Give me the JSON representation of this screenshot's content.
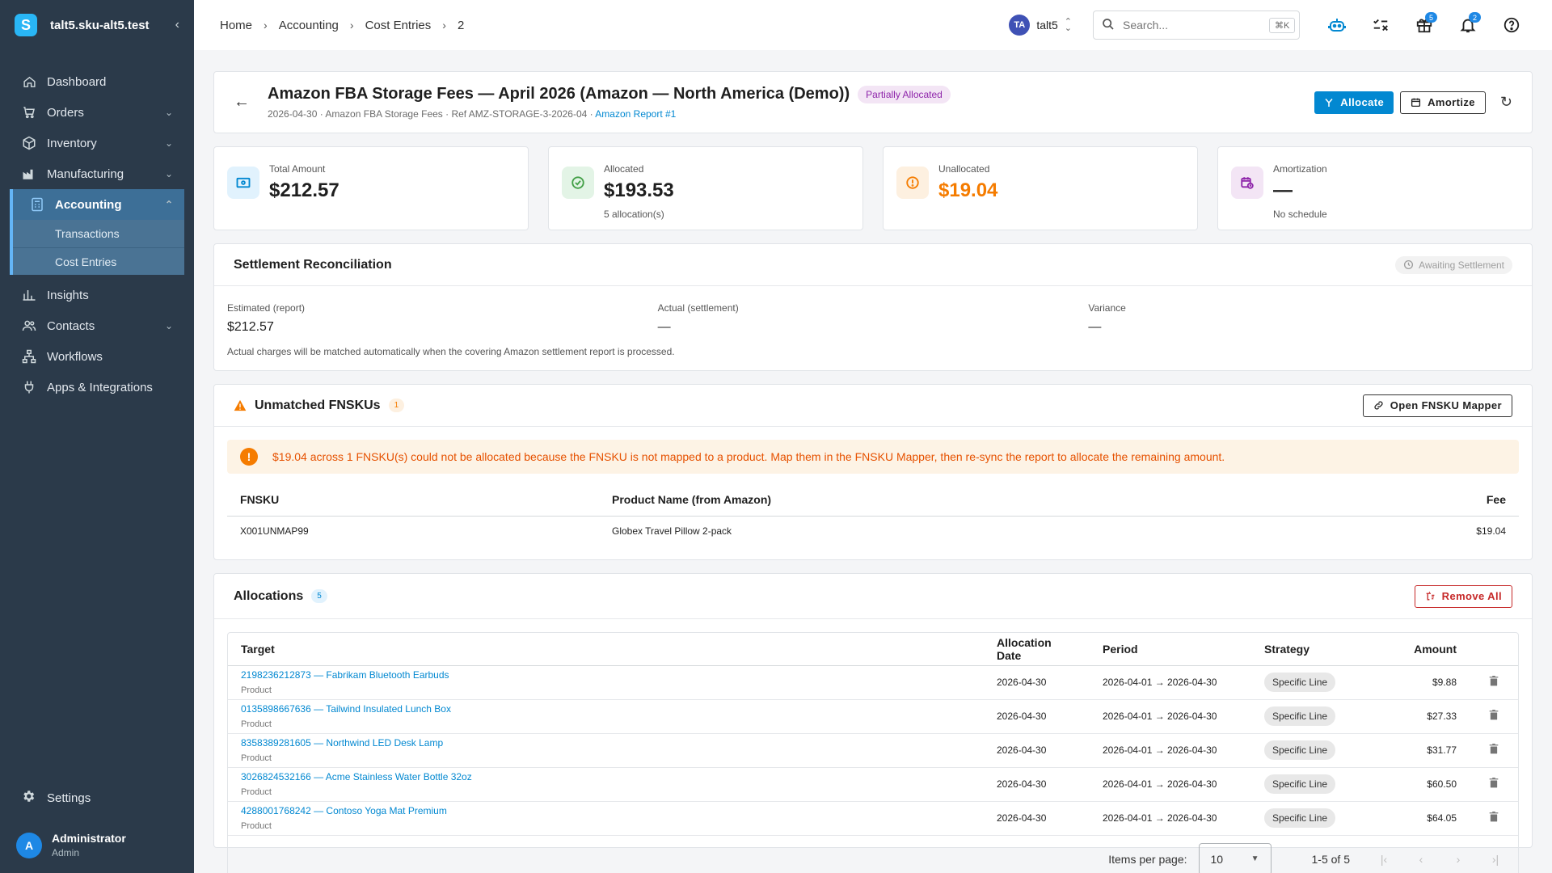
{
  "sidebar": {
    "tenant": "talt5.sku-alt5.test",
    "logo_letter": "S",
    "items": [
      {
        "label": "Dashboard",
        "icon": "home-icon"
      },
      {
        "label": "Orders",
        "icon": "cart-icon"
      },
      {
        "label": "Inventory",
        "icon": "box-icon"
      },
      {
        "label": "Manufacturing",
        "icon": "factory-icon"
      },
      {
        "label": "Accounting",
        "icon": "calculator-icon"
      },
      {
        "label": "Insights",
        "icon": "bar-chart-icon"
      },
      {
        "label": "Contacts",
        "icon": "people-icon"
      },
      {
        "label": "Workflows",
        "icon": "workflow-icon"
      },
      {
        "label": "Apps & Integrations",
        "icon": "plug-icon"
      }
    ],
    "accounting_sub": [
      "Transactions",
      "Cost Entries"
    ],
    "settings": "Settings",
    "user": {
      "initial": "A",
      "name": "Administrator",
      "role": "Admin"
    }
  },
  "topbar": {
    "breadcrumbs": [
      "Home",
      "Accounting",
      "Cost Entries",
      "2"
    ],
    "tenant_initials": "TA",
    "tenant_name": "talt5",
    "search_placeholder": "Search...",
    "search_shortcut": "⌘K",
    "gift_badge": "5",
    "bell_badge": "2"
  },
  "header": {
    "title": "Amazon FBA Storage Fees — April 2026 (Amazon — North America (Demo))",
    "status": "Partially Allocated",
    "sub_text": "2026-04-30 · Amazon FBA Storage Fees · Ref AMZ-STORAGE-3-2026-04 · ",
    "sub_link": "Amazon Report #1",
    "allocate": "Allocate",
    "amortize": "Amortize"
  },
  "stats": [
    {
      "label": "Total Amount",
      "value": "$212.57",
      "sub": "",
      "color": "#1f1f1f",
      "icon": "cash-icon"
    },
    {
      "label": "Allocated",
      "value": "$193.53",
      "sub": "5 allocation(s)",
      "color": "#1f1f1f",
      "icon": "check-circle-icon"
    },
    {
      "label": "Unallocated",
      "value": "$19.04",
      "sub": "",
      "color": "#f57c00",
      "icon": "alert-circle-icon"
    },
    {
      "label": "Amortization",
      "value": "—",
      "sub": "No schedule",
      "color": "#1f1f1f",
      "icon": "calendar-clock-icon"
    }
  ],
  "settlement": {
    "title": "Settlement Reconciliation",
    "badge": "Awaiting Settlement",
    "cols": [
      {
        "label": "Estimated (report)",
        "value": "$212.57"
      },
      {
        "label": "Actual (settlement)",
        "value": "—"
      },
      {
        "label": "Variance",
        "value": "—"
      }
    ],
    "note": "Actual charges will be matched automatically when the covering Amazon settlement report is processed."
  },
  "unmatched": {
    "title": "Unmatched FNSKUs",
    "count": "1",
    "button": "Open FNSKU Mapper",
    "alert": "$19.04 across 1 FNSKU(s) could not be allocated because the FNSKU is not mapped to a product. Map them in the FNSKU Mapper, then re-sync the report to allocate the remaining amount.",
    "headers": [
      "FNSKU",
      "Product Name (from Amazon)",
      "Fee"
    ],
    "rows": [
      {
        "fnsku": "X001UNMAP99",
        "name": "Globex Travel Pillow 2-pack",
        "fee": "$19.04"
      }
    ]
  },
  "allocations": {
    "title": "Allocations",
    "count": "5",
    "remove_all": "Remove All",
    "headers": [
      "Target",
      "Allocation Date",
      "Period",
      "Strategy",
      "Amount"
    ],
    "rows": [
      {
        "target": "2198236212873 — Fabrikam Bluetooth Earbuds",
        "kind": "Product",
        "date": "2026-04-30",
        "period": "2026-04-01 → 2026-04-30",
        "strategy": "Specific Line",
        "amount": "$9.88"
      },
      {
        "target": "0135898667636 — Tailwind Insulated Lunch Box",
        "kind": "Product",
        "date": "2026-04-30",
        "period": "2026-04-01 → 2026-04-30",
        "strategy": "Specific Line",
        "amount": "$27.33"
      },
      {
        "target": "8358389281605 — Northwind LED Desk Lamp",
        "kind": "Product",
        "date": "2026-04-30",
        "period": "2026-04-01 → 2026-04-30",
        "strategy": "Specific Line",
        "amount": "$31.77"
      },
      {
        "target": "3026824532166 — Acme Stainless Water Bottle 32oz",
        "kind": "Product",
        "date": "2026-04-30",
        "period": "2026-04-01 → 2026-04-30",
        "strategy": "Specific Line",
        "amount": "$60.50"
      },
      {
        "target": "4288001768242 — Contoso Yoga Mat Premium",
        "kind": "Product",
        "date": "2026-04-30",
        "period": "2026-04-01 → 2026-04-30",
        "strategy": "Specific Line",
        "amount": "$64.05"
      }
    ],
    "paginator": {
      "label": "Items per page:",
      "per_page": "10",
      "range": "1-5 of 5"
    }
  }
}
